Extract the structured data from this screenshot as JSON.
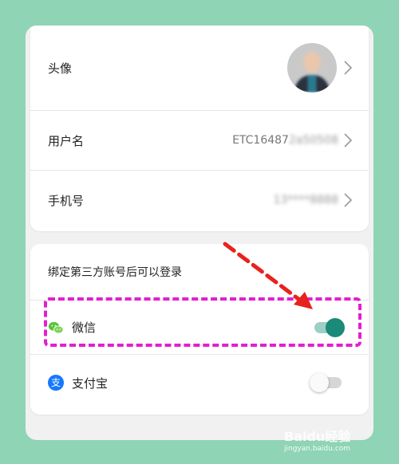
{
  "profile": {
    "avatar_label": "头像",
    "username_label": "用户名",
    "username_value": "ETC16487",
    "username_masked": "2a50508",
    "phone_label": "手机号",
    "phone_masked": "13****8888"
  },
  "third_party": {
    "section_title": "绑定第三方账号后可以登录",
    "items": [
      {
        "label": "微信",
        "icon": "wechat-icon",
        "enabled": true
      },
      {
        "label": "支付宝",
        "icon": "alipay-icon",
        "icon_glyph": "支",
        "enabled": false
      }
    ]
  },
  "colors": {
    "background": "#8fd4b5",
    "toggle_on": "#1a8a79",
    "toggle_on_track": "#9ccfc6",
    "highlight": "#e21fd0",
    "arrow": "#e8221d",
    "alipay": "#1677ff",
    "wechat": "#5ac53c"
  },
  "watermark": {
    "brand": "Baidu经验",
    "url": "jingyan.baidu.com"
  }
}
